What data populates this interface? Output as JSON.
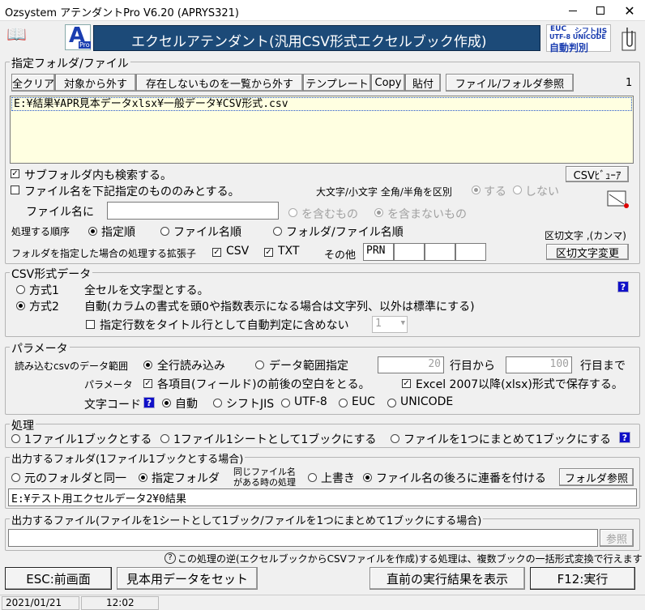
{
  "window": {
    "title": "Ozsystem アテンダントPro V6.20 (APRYS321)"
  },
  "header": {
    "banner": "エクセルアテンダント(汎用CSV形式エクセルブック作成)",
    "logo_letter": "A",
    "logo_sub": "Pro",
    "badge_line1_a": "EUC",
    "badge_line1_b": "シフトJIS",
    "badge_line2": "UTF-8 UNICODE",
    "badge_line3": "自動判別"
  },
  "files": {
    "legend": "指定フォルダ/ファイル",
    "toolbar": [
      "全クリア",
      "対象から外す",
      "存在しないものを一覧から外す",
      "テンプレート",
      "Copy",
      "貼付",
      "ファイル/フォルダ参照"
    ],
    "count": "1",
    "items": [
      "E:¥結果¥APR見本データxlsx¥一般データ¥CSV形式.csv"
    ],
    "subfolder_label": "サブフォルダ内も検索する。",
    "filename_only_label": "ファイル名を下記指定のもののみとする。",
    "case_label": "大文字/小文字 全角/半角を区別",
    "case_yes": "する",
    "case_no": "しない",
    "csv_viewer": "CSVﾋﾞｭｰｱ",
    "filename_label": "ファイル名に",
    "filename_value": "",
    "contains": "を含むもの",
    "not_contains": "を含まないもの",
    "order_label": "処理する順序",
    "order_options": [
      "指定順",
      "ファイル名順",
      "フォルダ/ファイル名順"
    ],
    "delimiter_label": "区切文字 ,(カンマ)",
    "ext_label": "フォルダを指定した場合の処理する拡張子",
    "ext_csv": "CSV",
    "ext_txt": "TXT",
    "ext_other_label": "その他",
    "ext_other_values": [
      "PRN",
      "",
      "",
      ""
    ],
    "delimiter_button": "区切文字変更"
  },
  "csv": {
    "legend": "CSV形式データ",
    "method1": "方式1",
    "method1_desc": "全セルを文字型とする。",
    "method2": "方式2",
    "method2_desc": "自動(カラムの書式を頭0や指数表示になる場合は文字列、以外は標準にする)",
    "title_rows_label": "指定行数をタイトル行として自動判定に含めない",
    "title_rows_value": "1",
    "help": "?"
  },
  "params": {
    "legend": "パラメータ",
    "range_label": "読み込むcsvのデータ範囲",
    "range_all": "全行読み込み",
    "range_spec": "データ範囲指定",
    "from_value": "20",
    "from_label": "行目から",
    "to_value": "100",
    "to_label": "行目まで",
    "param_label": "パラメータ",
    "trim_label": "各項目(フィールド)の前後の空白をとる。",
    "xlsx_label": "Excel 2007以降(xlsx)形式で保存する。",
    "encoding_label": "文字コード",
    "encodings": [
      "自動",
      "シフトJIS",
      "UTF-8",
      "EUC",
      "UNICODE"
    ],
    "help": "?"
  },
  "process": {
    "legend": "処理",
    "options": [
      "1ファイル1ブックとする",
      "1ファイル1シートとして1ブックにする",
      "ファイルを1つにまとめて1ブックにする"
    ],
    "help": "?"
  },
  "out_folder": {
    "legend": "出力するフォルダ(1ファイル1ブックとする場合)",
    "same": "元のフォルダと同一",
    "specified": "指定フォルダ",
    "same_name_line1": "同じファイル名",
    "same_name_line2": "がある時の処理",
    "overwrite": "上書き",
    "append_serial": "ファイル名の後ろに連番を付ける",
    "browse": "フォルダ参照",
    "path": "E:¥テスト用エクセルデータ2¥0結果"
  },
  "out_file": {
    "legend": "出力するファイル(ファイルを1シートとして1ブック/ファイルを1つにまとめて1ブックにする場合)",
    "path": "",
    "browse": "参照"
  },
  "note": {
    "text": "この処理の逆(エクセルブックからCSVファイルを作成)する処理は、複数ブックの一括形式変換で行えます"
  },
  "footer": {
    "esc": "ESC:前画面",
    "sample": "見本用データをセット",
    "last_result": "直前の実行結果を表示",
    "run": "F12:実行"
  },
  "status": {
    "date": "2021/01/21",
    "time": "12:02"
  },
  "colors": {
    "banner_bg": "#1c4a78",
    "list_bg": "#ffffe1",
    "help_bg": "#1010c8",
    "selection_border": "#2255cc"
  }
}
